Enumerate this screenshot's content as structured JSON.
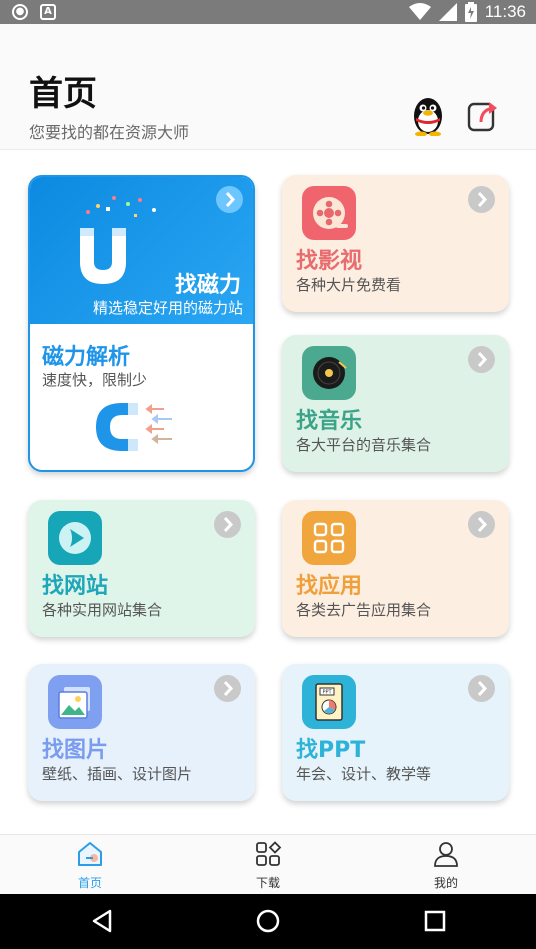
{
  "status_bar": {
    "time": "11:36",
    "left_icon_1": "shield-icon",
    "left_icon_2": "A",
    "icons": [
      "wifi-icon",
      "signal-icon",
      "battery-icon"
    ]
  },
  "header": {
    "title": "首页",
    "subtitle": "您要找的都在资源大师",
    "qq_icon": "qq-penguin-icon",
    "share_icon": "share-icon"
  },
  "cards": {
    "magnet": {
      "title": "找磁力",
      "subtitle": "精选稳定好用的磁力站",
      "title2": "磁力解析",
      "desc2": "速度快，限制少"
    },
    "video": {
      "title": "找影视",
      "desc": "各种大片免费看",
      "color": "#e86c6f"
    },
    "music": {
      "title": "找音乐",
      "desc": "各大平台的音乐集合",
      "color": "#3aa388"
    },
    "website": {
      "title": "找网站",
      "desc": "各种实用网站集合",
      "color": "#1fa7b9"
    },
    "app": {
      "title": "找应用",
      "desc": "各类去广告应用集合",
      "color": "#f0a03a"
    },
    "image": {
      "title": "找图片",
      "desc": "壁纸、插画、设计图片",
      "color": "#7a9cf0"
    },
    "ppt": {
      "title": "找PPT",
      "desc": "年会、设计、教学等",
      "color": "#2db3d8",
      "icon_text": "PPT"
    }
  },
  "bottom_nav": {
    "home": "首页",
    "download": "下载",
    "mine": "我的"
  }
}
